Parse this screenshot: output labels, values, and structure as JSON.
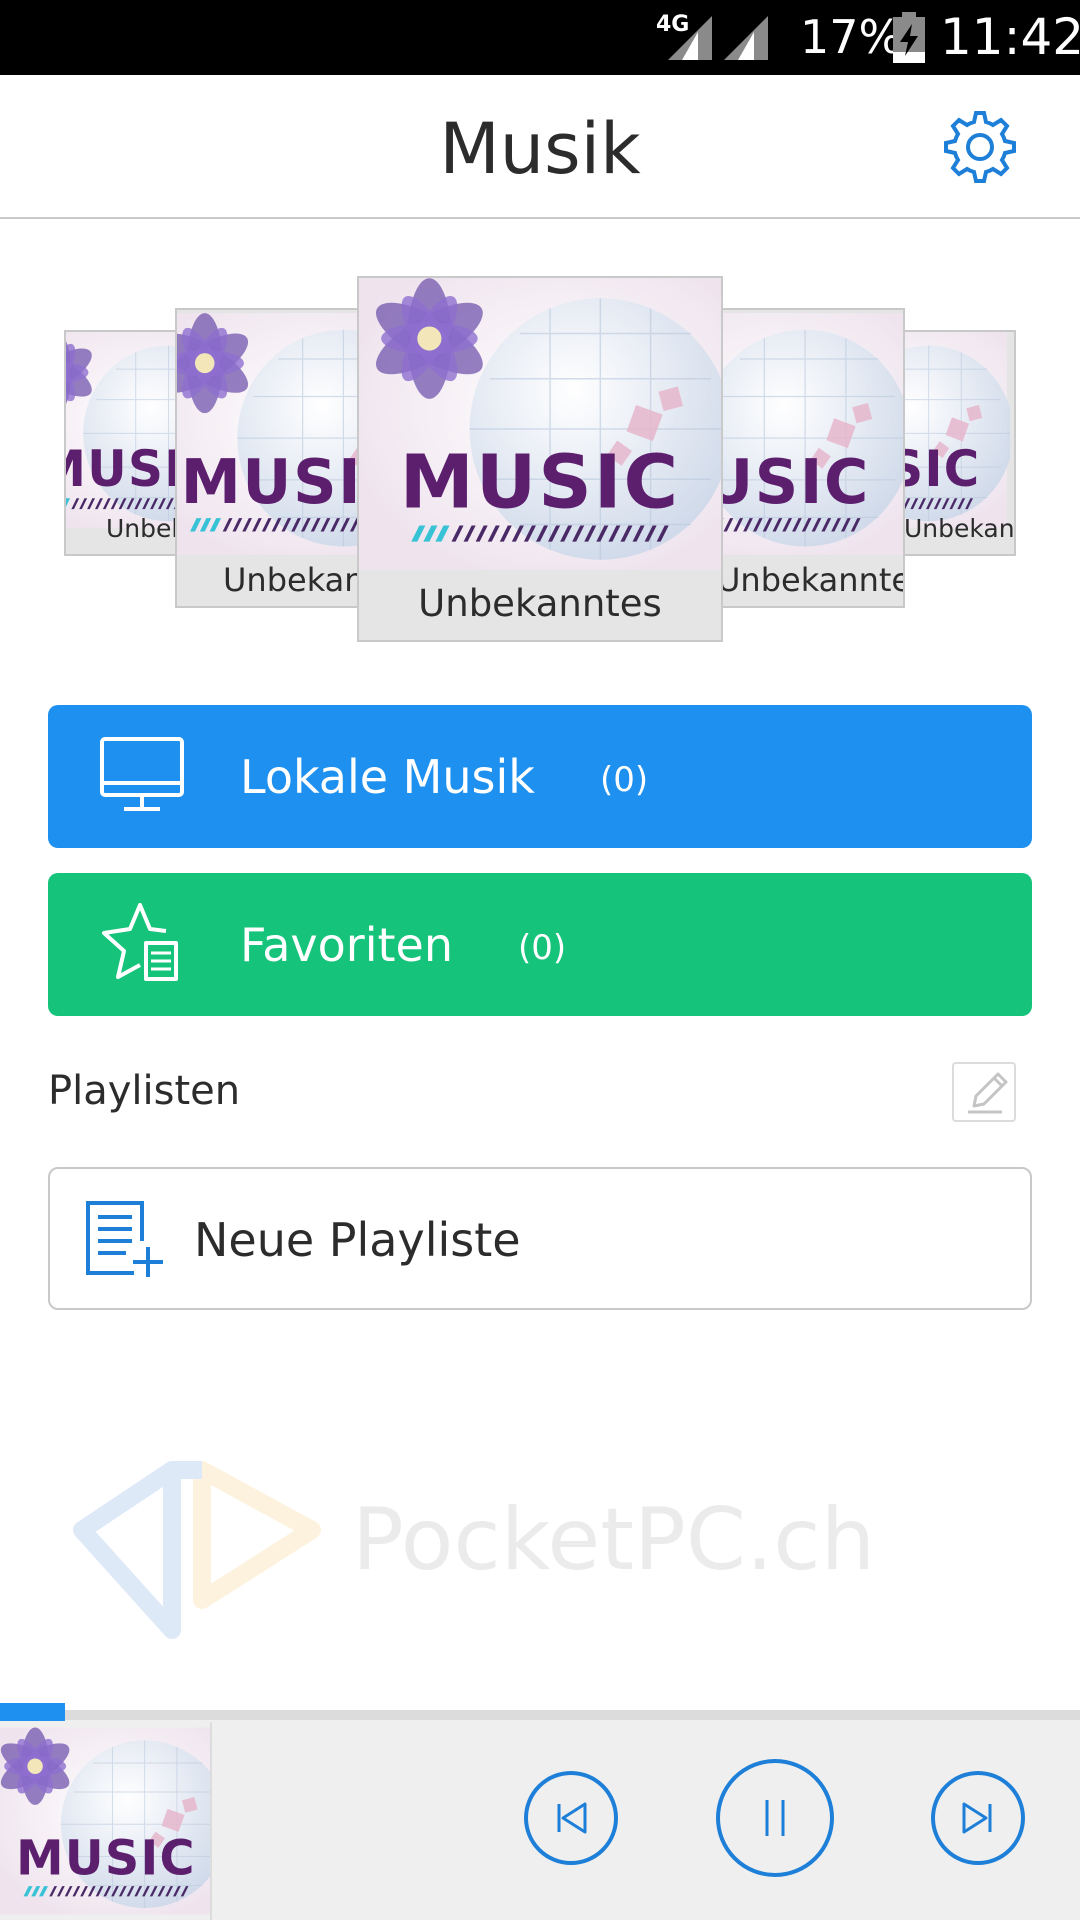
{
  "status_bar": {
    "network": "4G",
    "battery": "17%",
    "time": "11:42"
  },
  "header": {
    "title": "Musik",
    "settings_icon": "gear-icon"
  },
  "carousel": {
    "art_text": "MUSIC",
    "items": [
      {
        "label": "Unbekanntes"
      },
      {
        "label": "Unbekanntes"
      },
      {
        "label": "Unbekanntes"
      },
      {
        "label": "Unbekanntes"
      },
      {
        "label": "Unbekanntes"
      }
    ]
  },
  "library": {
    "local": {
      "label": "Lokale Musik",
      "count": "(0)",
      "icon": "monitor-icon",
      "color": "#1e90ef"
    },
    "favorites": {
      "label": "Favoriten",
      "count": "(0)",
      "icon": "star-list-icon",
      "color": "#16c37a"
    }
  },
  "playlists": {
    "title": "Playlisten",
    "edit_icon": "edit-icon",
    "new_label": "Neue Playliste",
    "new_icon": "playlist-add-icon"
  },
  "watermark": {
    "text": "PocketPC.ch"
  },
  "player": {
    "art_text": "MUSIC",
    "progress": 0.06,
    "accent": "#1e7fd8",
    "controls": [
      "previous-icon",
      "pause-icon",
      "next-icon"
    ]
  }
}
